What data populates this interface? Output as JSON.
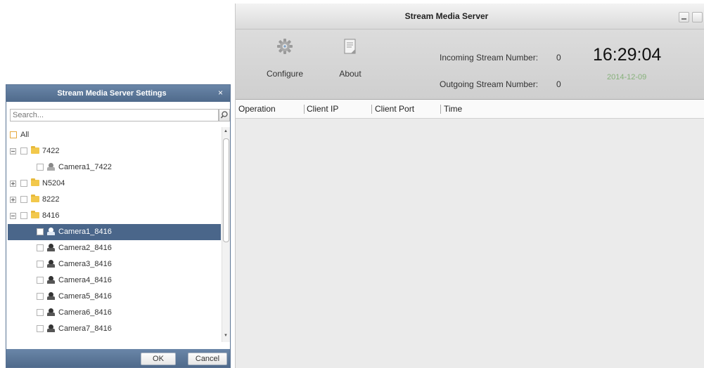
{
  "main_window": {
    "title": "Stream Media Server",
    "toolbar": {
      "configure_label": "Configure",
      "about_label": "About",
      "incoming_label": "Incoming Stream Number:",
      "incoming_value": "0",
      "outgoing_label": "Outgoing Stream Number:",
      "outgoing_value": "0",
      "time": "16:29:04",
      "date": "2014-12-09"
    },
    "table": {
      "columns": [
        "Operation",
        "Client IP",
        "Client Port",
        "Time"
      ]
    }
  },
  "settings_dialog": {
    "title": "Stream Media Server Settings",
    "close_glyph": "×",
    "search_placeholder": "Search...",
    "tree": [
      {
        "label": "All",
        "icon": "none",
        "expander": "none"
      },
      {
        "label": "7422",
        "icon": "folder-icon",
        "expander": "collapse"
      },
      {
        "label": "Camera1_7422",
        "icon": "camera-icon-offline",
        "expander": "none"
      },
      {
        "label": "N5204",
        "icon": "folder-icon",
        "expander": "expand"
      },
      {
        "label": "8222",
        "icon": "folder-icon",
        "expander": "expand"
      },
      {
        "label": "8416",
        "icon": "folder-icon",
        "expander": "collapse"
      },
      {
        "label": "Camera1_8416",
        "icon": "camera-icon",
        "expander": "none",
        "selected": true
      },
      {
        "label": "Camera2_8416",
        "icon": "camera-icon",
        "expander": "none"
      },
      {
        "label": "Camera3_8416",
        "icon": "camera-icon",
        "expander": "none"
      },
      {
        "label": "Camera4_8416",
        "icon": "camera-icon",
        "expander": "none"
      },
      {
        "label": "Camera5_8416",
        "icon": "camera-icon",
        "expander": "none"
      },
      {
        "label": "Camera6_8416",
        "icon": "camera-icon",
        "expander": "none"
      },
      {
        "label": "Camera7_8416",
        "icon": "camera-icon",
        "expander": "none"
      }
    ],
    "ok_label": "OK",
    "cancel_label": "Cancel"
  },
  "colors": {
    "dialog_header": "#4f6a8b",
    "selected_row": "#4a668a",
    "date_green": "#86b17a",
    "folder_yellow": "#f2c84b"
  }
}
